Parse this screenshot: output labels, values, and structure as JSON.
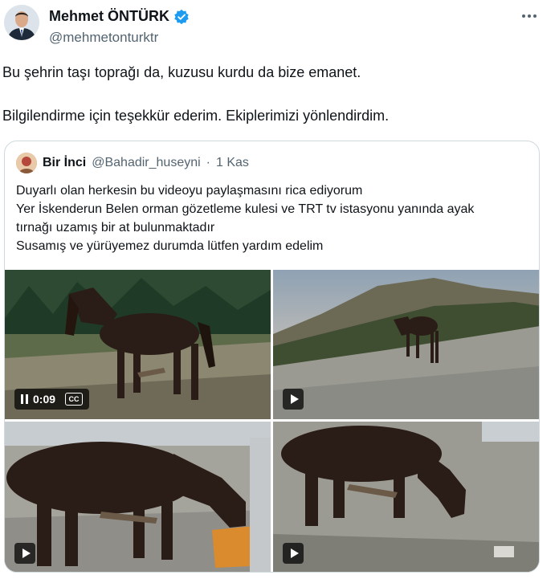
{
  "author": {
    "display_name": "Mehmet ÖNTÜRK",
    "handle": "@mehmetonturktr",
    "verified_icon": "verified-badge-icon",
    "badge_color": "#1d9bf0"
  },
  "tweet": {
    "paragraph_1": "Bu şehrin taşı toprağı da, kuzusu kurdu da bize emanet.",
    "paragraph_2": "Bilgilendirme için teşekkür ederim. Ekiplerimizi yönlendirdim."
  },
  "quote": {
    "name": "Bir İnci",
    "handle": "@Bahadir_huseyni",
    "separator": "·",
    "date": "1 Kas",
    "lines": [
      "Duyarlı olan herkesin bu videoyu paylaşmasını rica ediyorum",
      "Yer İskenderun Belen orman gözetleme kulesi ve TRT tv istasyonu yanında ayak",
      "tırnağı uzamış bir at bulunmaktadır",
      "Susamış ve yürüyemez durumda lütfen yardım edelim"
    ],
    "media": {
      "video_time": "0:09",
      "cc_label": "CC"
    }
  },
  "colors": {
    "text": "#0f1419",
    "secondary": "#536471",
    "border": "#cfd9de"
  }
}
